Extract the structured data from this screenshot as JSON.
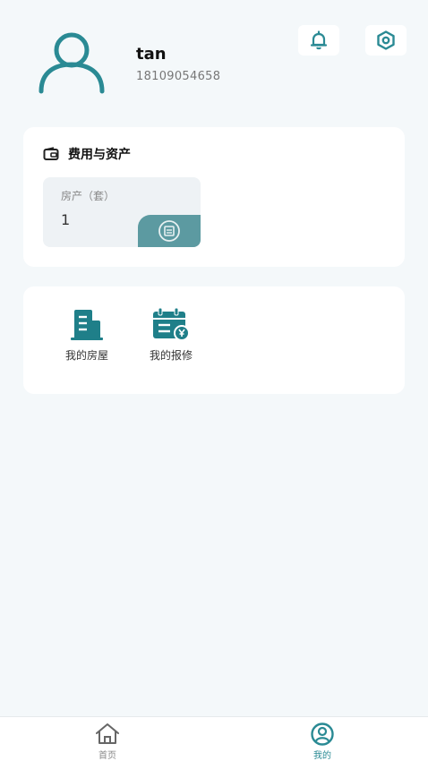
{
  "profile": {
    "username": "tan",
    "phone": "18109054658"
  },
  "header_icons": {
    "notification": "bell-icon",
    "settings": "settings-icon"
  },
  "assets_section": {
    "title": "费用与资产",
    "property_label": "房产（套）",
    "property_count": "1"
  },
  "menu": {
    "items": [
      {
        "label": "我的房屋",
        "icon": "building-icon"
      },
      {
        "label": "我的报修",
        "icon": "repair-calendar-icon"
      }
    ]
  },
  "bottom_nav": {
    "items": [
      {
        "label": "首页",
        "icon": "home-icon"
      },
      {
        "label": "我的",
        "icon": "user-circle-icon"
      }
    ]
  },
  "colors": {
    "accent": "#2a8a94",
    "background": "#f4f8fa",
    "card": "#ffffff"
  }
}
